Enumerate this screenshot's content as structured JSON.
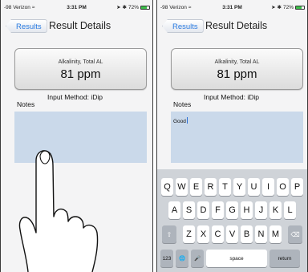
{
  "phones": {
    "left": {
      "status": {
        "carrier": "-98 Verizon",
        "time": "3:31 PM",
        "battery": "72%",
        "battery_level": 0.72
      },
      "nav": {
        "back_label": "Results",
        "title": "Result Details"
      },
      "result": {
        "label": "Alkalinity, Total AL",
        "value": "81 ppm"
      },
      "notes_label": "Notes",
      "input_method": "Input Method: iDip",
      "notes_text": ""
    },
    "right": {
      "status": {
        "carrier": "-98 Verizon",
        "time": "3:31 PM",
        "battery": "72%",
        "battery_level": 0.72
      },
      "nav": {
        "back_label": "Results",
        "title": "Result Details"
      },
      "result": {
        "label": "Alkalinity, Total AL",
        "value": "81 ppm"
      },
      "notes_label": "Notes",
      "input_method": "Input Method: iDip",
      "notes_text": "Good",
      "keyboard": {
        "row1": [
          "Q",
          "W",
          "E",
          "R",
          "T",
          "Y",
          "U",
          "I",
          "O",
          "P"
        ],
        "row2": [
          "A",
          "S",
          "D",
          "F",
          "G",
          "H",
          "J",
          "K",
          "L"
        ],
        "row3": [
          "Z",
          "X",
          "C",
          "V",
          "B",
          "N",
          "M"
        ],
        "numbers_key": "123",
        "space_key": "space",
        "return_key": "return"
      }
    }
  },
  "icons": [
    "wifi-icon",
    "location-arrow-icon",
    "bluetooth-icon",
    "battery-icon",
    "shift-icon",
    "delete-icon",
    "globe-icon",
    "microphone-icon",
    "finger-illustration"
  ],
  "colors": {
    "accent": "#2a7be0",
    "notes_bg": "#cad9ea",
    "keyboard_bg": "#cfd3d8",
    "battery_green": "#3cc04a"
  }
}
